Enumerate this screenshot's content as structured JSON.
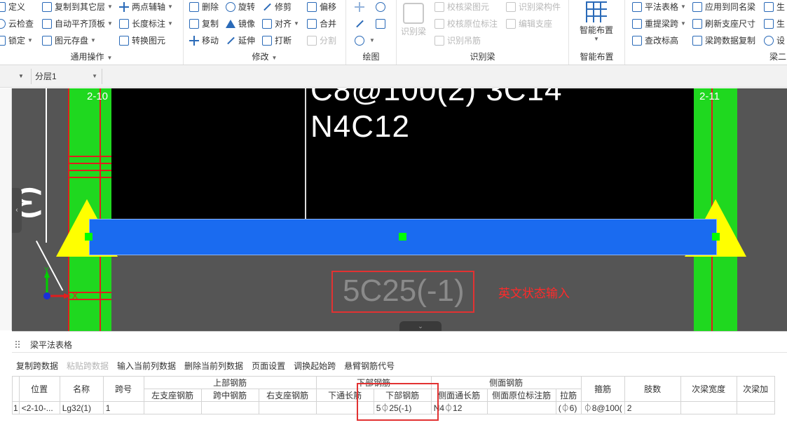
{
  "ribbon": {
    "groups": [
      {
        "id": "general",
        "title": "通用操作"
      },
      {
        "id": "modify",
        "title": "修改"
      },
      {
        "id": "draw",
        "title": "绘图"
      },
      {
        "id": "identify",
        "title": "识别梁"
      },
      {
        "id": "smart",
        "title": "智能布置"
      },
      {
        "id": "beam",
        "title": "梁二"
      }
    ],
    "general": {
      "c1": [
        "定义",
        "云检查",
        "锁定"
      ],
      "c2": [
        "复制到其它层",
        "自动平齐顶板",
        "图元存盘"
      ],
      "c3": [
        "两点辅轴",
        "长度标注",
        "转换图元"
      ]
    },
    "modify": {
      "c1": [
        "删除",
        "复制",
        "移动"
      ],
      "c2": [
        "旋转",
        "镜像",
        "延伸"
      ],
      "c3": [
        "修剪",
        "对齐",
        "打断"
      ],
      "c4": [
        "偏移",
        "合并",
        "分割"
      ]
    },
    "identify": {
      "big": "识别梁",
      "c1": [
        "校核梁图元",
        "校核原位标注",
        "识别吊筋"
      ],
      "c2": [
        "识别梁构件",
        "编辑支座"
      ]
    },
    "smart": {
      "big": "智能布置"
    },
    "beam": {
      "c1": [
        "平法表格",
        "重提梁跨",
        "查改标高"
      ],
      "c2": [
        "应用到同名梁",
        "刷新支座尺寸",
        "梁跨数据复制"
      ],
      "c3": [
        "生",
        "生",
        "设"
      ]
    }
  },
  "layerbar": {
    "floor": "分层1"
  },
  "canvas": {
    "axis_left": "2-10",
    "axis_right": "2-11",
    "top_text": "C8@100(2) 3C14",
    "side_text": "N4C12",
    "bottom_rebar": "5C25(-1)",
    "annotation": "英文状态输入",
    "ucs_x": "X",
    "ucs_y": "Y",
    "colors": {
      "bg": "#555555",
      "black": "#000000",
      "green": "#1fd81f",
      "beam": "#1a6bf0",
      "support": "#ffff00",
      "red": "#e01e1e"
    }
  },
  "panel": {
    "title": "梁平法表格",
    "toolbar": [
      {
        "label": "复制跨数据",
        "enabled": true
      },
      {
        "label": "粘贴跨数据",
        "enabled": false
      },
      {
        "label": "输入当前列数据",
        "enabled": true
      },
      {
        "label": "删除当前列数据",
        "enabled": true
      },
      {
        "label": "页面设置",
        "enabled": true
      },
      {
        "label": "调换起始跨",
        "enabled": true
      },
      {
        "label": "悬臂钢筋代号",
        "enabled": true
      }
    ],
    "headers": {
      "position": "位置",
      "name": "名称",
      "span": "跨号",
      "top_group": "上部钢筋",
      "top_left": "左支座钢筋",
      "top_mid": "跨中钢筋",
      "top_right": "右支座钢筋",
      "bottom_group": "下部钢筋",
      "bottom_through": "下通长筋",
      "bottom_rebar": "下部钢筋",
      "side_group": "侧面钢筋",
      "side_through": "侧面通长筋",
      "side_inplace": "侧面原位标注筋",
      "tie": "拉筋",
      "stirrup": "箍筋",
      "legs": "肢数",
      "sub_width": "次梁宽度",
      "sub_add": "次梁加"
    },
    "row": {
      "index": "1",
      "position": "<2-10-...",
      "name": "Lg32(1)",
      "span": "1",
      "top_left": "",
      "top_mid": "",
      "top_right": "",
      "bottom_through": "",
      "bottom_rebar": "5⏀25(-1)",
      "side_through": "N4⏀12",
      "side_inplace": "",
      "tie": "(⏀6)",
      "stirrup": "⏀8@100(",
      "legs": "2",
      "sub_width": "",
      "sub_add": ""
    }
  }
}
